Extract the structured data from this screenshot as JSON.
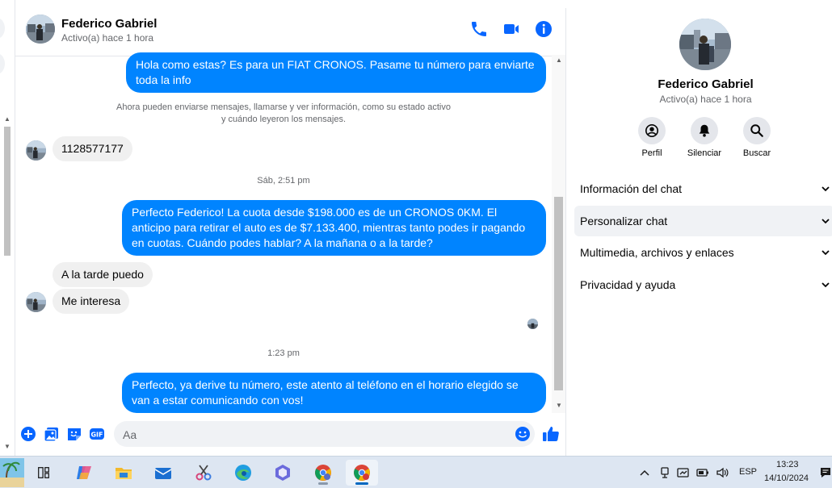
{
  "contact": {
    "name": "Federico Gabriel",
    "status": "Activo(a) hace 1 hora"
  },
  "messages": {
    "out_1": "Hola como estas?  Es para un FIAT CRONOS. Pasame tu número para enviarte toda la info",
    "system_line1": "Ahora pueden enviarse mensajes, llamarse y ver información, como su estado activo",
    "system_line2": "y cuándo leyeron los mensajes.",
    "in_1": "1128577177",
    "time_1": "Sáb, 2:51 pm",
    "out_2": "Perfecto Federico!  La cuota desde $198.000 es de un CRONOS 0KM. El anticipo para retirar el auto es de $7.133.400, mientras tanto podes ir pagando en cuotas. Cuándo podes hablar? A la mañana o a la tarde?",
    "in_2": "A la tarde puedo",
    "in_3": "Me interesa",
    "time_2": "1:23 pm",
    "out_3": "Perfecto, ya derive tu número, este atento al teléfono en el horario elegido se van a estar comunicando con vos!"
  },
  "composer": {
    "placeholder": "Aa"
  },
  "right_panel": {
    "name": "Federico Gabriel",
    "status": "Activo(a) hace 1 hora",
    "actions": {
      "profile": "Perfil",
      "mute": "Silenciar",
      "search": "Buscar"
    },
    "sections": {
      "chat_info": "Información del chat",
      "customize": "Personalizar chat",
      "media": "Multimedia, archivos y enlaces",
      "privacy": "Privacidad y ayuda"
    }
  },
  "taskbar": {
    "language": "ESP",
    "time": "13:23",
    "date": "14/10/2024"
  },
  "colors": {
    "accent": "#0084ff",
    "icon_blue": "#0866ff",
    "incoming_bubble": "#f0f0f0"
  }
}
